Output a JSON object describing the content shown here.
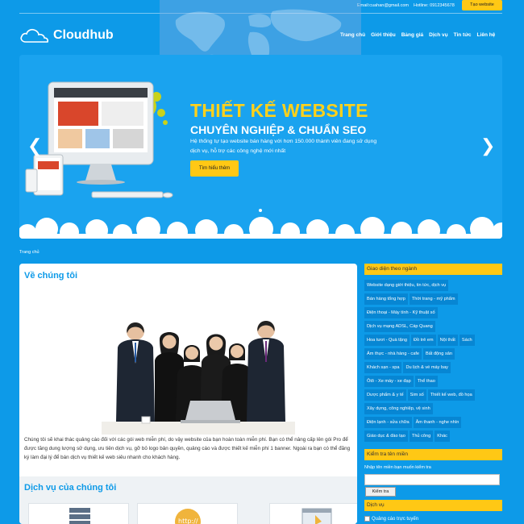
{
  "topbar": {
    "email": "Email:cuahan@gmail.com",
    "hotline": "Hotline: 0912345678",
    "cta": "Tạo website"
  },
  "brand": {
    "name": "Cloudhub"
  },
  "nav": [
    "Trang chủ",
    "Giới thiệu",
    "Bảng giá",
    "Dịch vụ",
    "Tin tức",
    "Liên hệ"
  ],
  "slider": {
    "title": "THIẾT KẾ WEBSITE",
    "subtitle": "CHUYÊN NGHIỆP & CHUẨN SEO",
    "description": "Hệ thống tự tạo website bán hàng với hơn 150.000 thành viên đang sử dụng dịch vụ, hỗ trợ các công nghệ mới nhất",
    "button": "Tìm hiểu thêm"
  },
  "breadcrumb": "Trang chủ",
  "about": {
    "title": "Về chúng tôi",
    "text": "Chúng tôi sẽ khai thác quảng cáo đối với các gói web miễn phí, do vậy website của bạn hoàn toàn miễn phí. Bạn có thể nâng cấp lên gói Pro để được tăng dung lượng sử dụng, ưu tiên dịch vụ, gỡ bỏ logo bản quyền, quảng cáo và được thiết kế miễn phí 1 banner. Ngoài ra bạn có thể đăng ký làm đại lý để bán dịch vụ thiết kế web siêu nhanh cho khách hàng."
  },
  "services": {
    "title": "Dịch vụ của chúng tôi"
  },
  "sidebar": {
    "themes_title": "Giao diện theo ngành",
    "tags": [
      [
        "Website dạng giới thiệu, tin tức, dịch vụ"
      ],
      [
        "Bán hàng tổng hợp",
        "Thời trang - mỹ phẩm"
      ],
      [
        "Điện thoại - Máy tính - Kỹ thuật số"
      ],
      [
        "Dịch vụ mạng ADSL, Cáp Quang"
      ],
      [
        "Hoa tươi - Quà tặng",
        "Đồ trẻ em",
        "Nội thất",
        "Sách"
      ],
      [
        "Ẩm thực - nhà hàng - cafe",
        "Bất động sản"
      ],
      [
        "Khách sạn - spa",
        "Du lịch & vé máy bay"
      ],
      [
        "Ôtô - Xe máy - xe đạp",
        "Thể thao"
      ],
      [
        "Dược phẩm & y tế",
        "Sim số",
        "Thiết kế web, đồ họa"
      ],
      [
        "Xây dựng, công nghiệp, vệ sinh"
      ],
      [
        "Điện lạnh - sửa chữa",
        "Âm thanh - nghe nhìn"
      ],
      [
        "Giáo dục & đào tạo",
        "Thủ công",
        "Khác"
      ]
    ],
    "domain_title": "Kiểm tra tên miền",
    "domain_label": "Nhập tên miền bạn muốn kiểm tra",
    "domain_placeholder": "",
    "domain_button": "Kiểm tra",
    "service_title": "Dịch vụ",
    "service_option": "Quảng cáo trực tuyến"
  },
  "colors": {
    "background": "#0d9ae8",
    "accent": "#ffc815",
    "tag": "#0786d3"
  }
}
